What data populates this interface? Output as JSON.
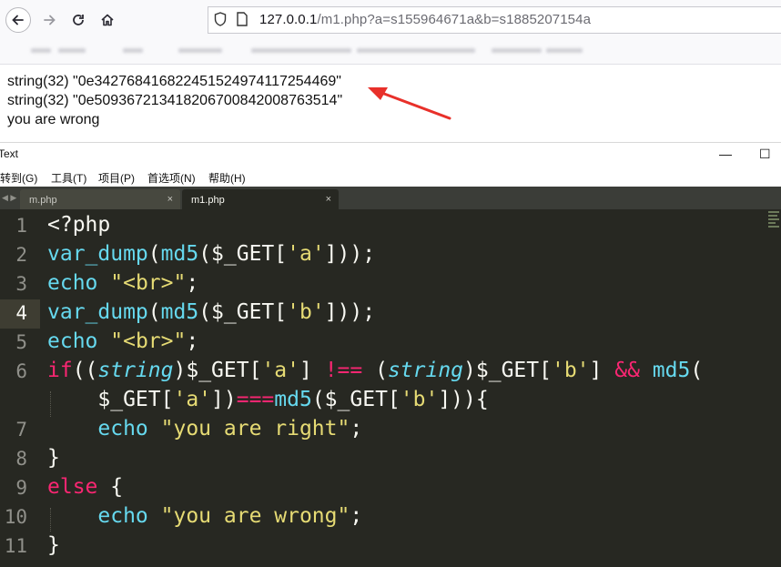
{
  "browser": {
    "url_host": "127.0.0.1",
    "url_path": "/m1.php?a=s155964671a&b=s1885207154a"
  },
  "page_output": {
    "lines": [
      "string(32) \"0e342768416822451524974117254469\"",
      "string(32) \"0e509367213418206700842008763514\"",
      "you are wrong"
    ]
  },
  "editor": {
    "window_title": "Text",
    "min_glyph": "—",
    "max_glyph": "☐",
    "menu": [
      "转到(G)",
      "工具(T)",
      "项目(P)",
      "首选项(N)",
      "帮助(H)"
    ],
    "tabs": [
      {
        "label": "m.php",
        "active": false
      },
      {
        "label": "m1.php",
        "active": true
      }
    ],
    "close_glyph": "×",
    "line_numbers": [
      "1",
      "2",
      "3",
      "4",
      "5",
      "6",
      "7",
      "8",
      "9",
      "10",
      "11"
    ],
    "code_lines": [
      "<?php",
      "var_dump(md5($_GET['a']));",
      "echo \"<br>\";",
      "var_dump(md5($_GET['b']));",
      "echo \"<br>\";",
      "if((string)$_GET['a'] !== (string)$_GET['b'] && md5(",
      "    $_GET['a'])===md5($_GET['b'])){",
      "    echo \"you are right\";",
      "}",
      "else {",
      "    echo \"you are wrong\";",
      "}"
    ]
  },
  "colors": {
    "editor_bg": "#272822",
    "keyword": "#f92672",
    "function": "#66d9ef",
    "string": "#e6db74",
    "arrow": "#e8302a"
  },
  "icons": [
    "back-arrow-icon",
    "forward-arrow-icon",
    "reload-icon",
    "home-icon",
    "shield-icon",
    "page-icon",
    "close-icon",
    "annotation-arrow"
  ]
}
